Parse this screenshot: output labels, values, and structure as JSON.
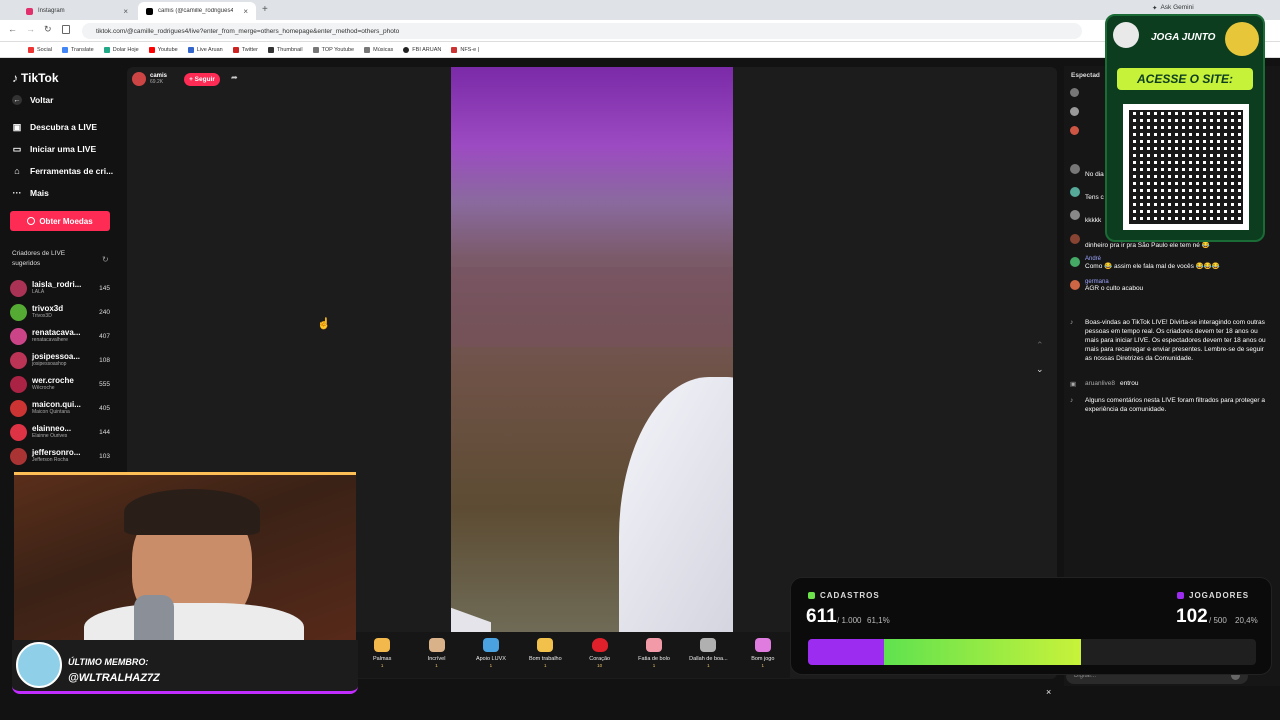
{
  "browser": {
    "tabs": [
      {
        "title": "Instagram",
        "active": false
      },
      {
        "title": "camis (@camille_rodrigues4) | ...",
        "active": true
      }
    ],
    "url": "tiktok.com/@camille_rodrigues4/live?enter_from_merge=others_homepage&enter_method=others_photo",
    "ask_gemini": "Ask Gemini",
    "bookmarks": [
      "Social",
      "Translate",
      "Dolar Hoje",
      "Youtube",
      "Live Aruan",
      "Twitter",
      "Thumbnail",
      "TOP Youtube",
      "Músicas",
      "FBI ARUAN",
      "NFS-e |"
    ]
  },
  "tiktok": {
    "logo": "TikTok",
    "back": "Voltar",
    "nav": [
      "Descubra a LIVE",
      "Iniciar uma LIVE",
      "Ferramentas de cri...",
      "Mais"
    ],
    "coins_button": "Obter Moedas",
    "suggested_title": "Criadores de LIVE sugeridos",
    "creators": [
      {
        "name": "laisla_rodri...",
        "sub": "LALÁ",
        "count": "145"
      },
      {
        "name": "trivox3d",
        "sub": "Trivox3D",
        "count": "240"
      },
      {
        "name": "renatacava...",
        "sub": "renatacavalhere",
        "count": "407"
      },
      {
        "name": "josipessoa...",
        "sub": "josipessoashop",
        "count": "108"
      },
      {
        "name": "wer.croche",
        "sub": "Wêcroche",
        "count": "555"
      },
      {
        "name": "maicon.qui...",
        "sub": "Maicon Quintana",
        "count": "405"
      },
      {
        "name": "elainneo...",
        "sub": "Elainne Ourives",
        "count": "144"
      },
      {
        "name": "jeffersonro...",
        "sub": "Jefferson Rocha",
        "count": "103"
      }
    ],
    "host": {
      "name": "camis",
      "likes": "69.2K",
      "follow": "+ Seguir"
    },
    "gifts": [
      {
        "label": "Palmas",
        "price": "1",
        "color": "#f2b84b"
      },
      {
        "label": "Incrível",
        "price": "1",
        "color": "#d9b28a"
      },
      {
        "label": "Apoio LUVX",
        "price": "1",
        "color": "#4aa3e0"
      },
      {
        "label": "Bom trabalho",
        "price": "1",
        "color": "#f2c14b"
      },
      {
        "label": "Coração",
        "price": "10",
        "color": "#e0202a"
      },
      {
        "label": "Fatia de bolo",
        "price": "1",
        "color": "#f29aa8"
      },
      {
        "label": "Dallah de boa...",
        "price": "1",
        "color": "#b0b0b0"
      },
      {
        "label": "Bom jogo",
        "price": "1",
        "color": "#e07be0"
      }
    ]
  },
  "chat": {
    "viewers_label": "Espectad",
    "messages": [
      {
        "user": "",
        "text": "No dia"
      },
      {
        "user": "",
        "text": "Tens c"
      },
      {
        "user": "",
        "text": "kkkkk"
      },
      {
        "user": "",
        "text": "dinheiro pra ir pra São Paulo ele tem né 😂"
      },
      {
        "user": "André",
        "text": "Como 😂 assim ele fala mal de vocês 😂😂😂"
      },
      {
        "user": "germana",
        "text": "AGR o culto acabou"
      }
    ],
    "welcome": "Boas-vindas ao TikTok LIVE! Divirta-se interagindo com outras pessoas em tempo real. Os criadores devem ter 18 anos ou mais para iniciar LIVE. Os espectadores devem ter 18 anos ou mais para recarregar e enviar presentes. Lembre-se de seguir as nossas Diretrizes da Comunidade.",
    "joined_user": "aruanlive8",
    "joined_text": "entrou",
    "filtered": "Alguns comentários nesta LIVE foram filtrados para proteger a experiência da comunidade.",
    "input_placeholder": "Digitar..."
  },
  "ad": {
    "brand": "JOGA JUNTO",
    "cta": "ACESSE O SITE:"
  },
  "member": {
    "label": "ÚLTIMO MEMBRO:",
    "name": "@WLTRALHAZ7Z"
  },
  "stats": {
    "left_label": "CADASTROS",
    "left_value": "611",
    "left_goal": "/ 1.000",
    "left_pct": "61,1%",
    "right_label": "JOGADORES",
    "right_value": "102",
    "right_goal": "/ 500",
    "right_pct": "20,4%",
    "purple_fill": 0.17,
    "green_fill": 0.61,
    "colors": {
      "green": "#6ce34a",
      "purple": "#9b2cf0"
    }
  }
}
